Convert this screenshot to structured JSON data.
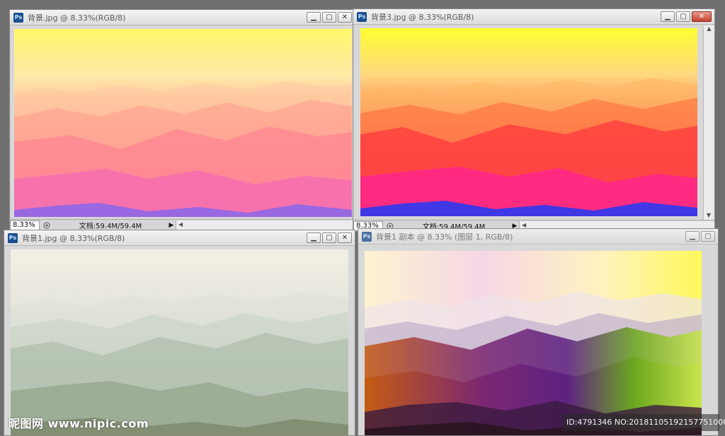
{
  "windows": [
    {
      "title": "背景.jpg @ 8.33%(RGB/8)",
      "zoom": "8.33%",
      "doc_info": "文档:59.4M/59.4M",
      "buttons": {
        "minimize": "▁",
        "maximize": "▢",
        "close": "✕"
      }
    },
    {
      "title": "背景3.jpg @ 8.33%(RGB/8)",
      "zoom": "8.33%",
      "doc_info": "文档:59.4M/59.4M",
      "buttons": {
        "minimize": "▁",
        "maximize": "▢",
        "close": "✕"
      }
    },
    {
      "title": "背景1.jpg @ 8.33%(RGB/8)",
      "buttons": {
        "minimize": "▁",
        "maximize": "▢",
        "close": "✕"
      }
    },
    {
      "title": "背景1 副本 @ 8.33% (图层 1, RGB/8)",
      "buttons": {
        "minimize": "▁",
        "maximize": "▢"
      }
    }
  ],
  "app_icon_label": "Ps",
  "icons": {
    "status_arrow": "▶",
    "scroll_left": "◀",
    "scroll_up": "▲",
    "scroll_down": "▼"
  },
  "watermark": {
    "left": "昵图网 www.nipic.com",
    "right": "ID:4791346 NO:20181105192157751000"
  },
  "colors": {
    "window1_sky": "#fff86a",
    "window2_sky": "#ffff30",
    "window3_sky": "#f3efe4",
    "window4_sky": "#fdf2d0"
  }
}
